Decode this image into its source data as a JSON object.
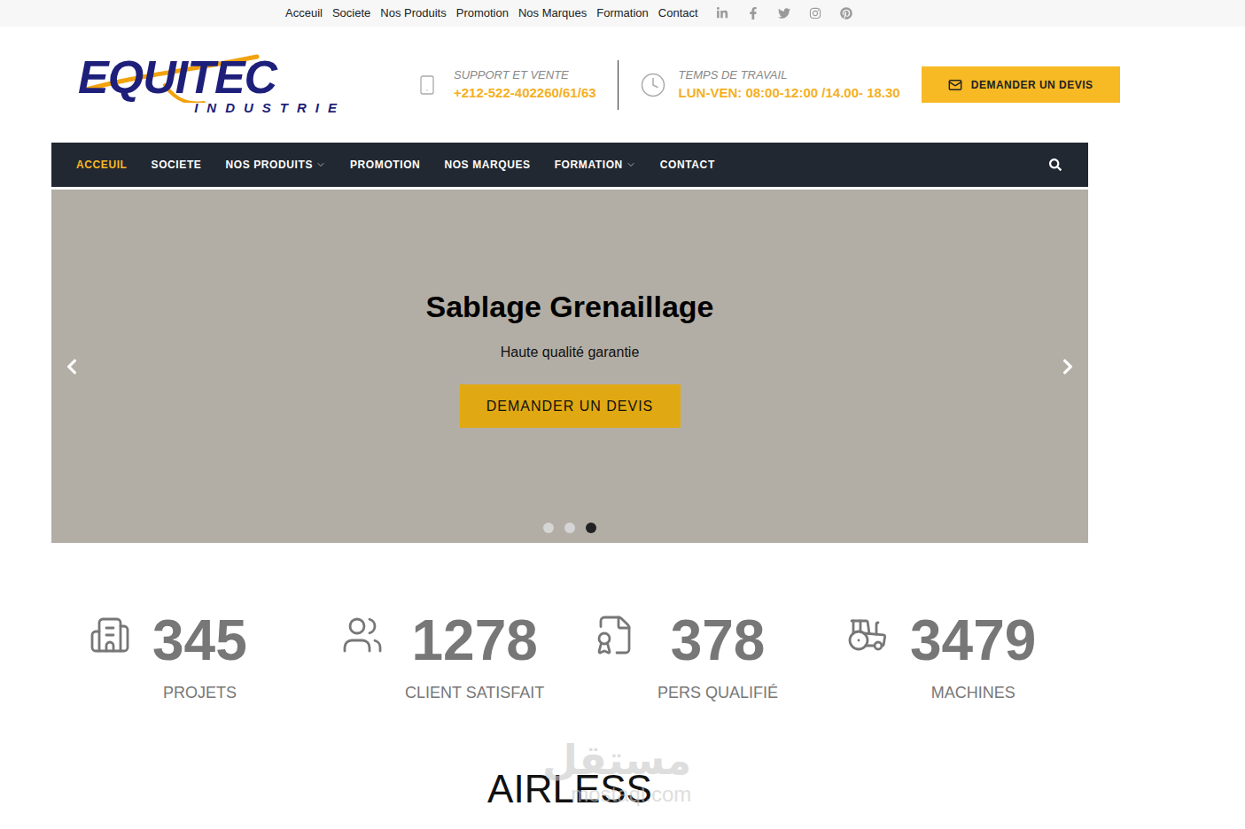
{
  "top_bar": {
    "links": [
      "Acceuil",
      "Societe",
      "Nos Produits",
      "Promotion",
      "Nos Marques",
      "Formation",
      "Contact"
    ],
    "social": [
      "linkedin",
      "facebook",
      "twitter",
      "instagram",
      "pinterest"
    ]
  },
  "header": {
    "logo": {
      "name": "EQUITEC",
      "tagline": "INDUSTRIE"
    },
    "support": {
      "label": "SUPPORT ET VENTE",
      "value": "+212-522-402260/61/63"
    },
    "hours": {
      "label": "TEMPS DE TRAVAIL",
      "value": "LUN-VEN: 08:00-12:00 /14.00- 18.30"
    },
    "quote_button": "DEMANDER UN DEVIS"
  },
  "nav": {
    "items": [
      {
        "label": "ACCEUIL",
        "selected": true,
        "dropdown": false
      },
      {
        "label": "SOCIETE",
        "selected": false,
        "dropdown": false
      },
      {
        "label": "NOS PRODUITS",
        "selected": false,
        "dropdown": true
      },
      {
        "label": "PROMOTION",
        "selected": false,
        "dropdown": false
      },
      {
        "label": "NOS MARQUES",
        "selected": false,
        "dropdown": false
      },
      {
        "label": "FORMATION",
        "selected": false,
        "dropdown": true
      },
      {
        "label": "CONTACT",
        "selected": false,
        "dropdown": false
      }
    ]
  },
  "hero": {
    "title": "Sablage Grenaillage",
    "subtitle": "Haute qualité garantie",
    "button": "DEMANDER UN DEVIS",
    "slides": [
      {
        "selected": false
      },
      {
        "selected": false
      },
      {
        "selected": true
      }
    ]
  },
  "stats": [
    {
      "icon": "building",
      "value": "345",
      "label": "PROJETS"
    },
    {
      "icon": "users",
      "value": "1278",
      "label": "CLIENT SATISFAIT"
    },
    {
      "icon": "certificate",
      "value": "378",
      "label": "PERS QUALIFIÉ"
    },
    {
      "icon": "tractor",
      "value": "3479",
      "label": "MACHINES"
    }
  ],
  "section_title": "AIRLESS",
  "watermark": {
    "arabic": "مستقل",
    "latin": "mostaql.com"
  }
}
